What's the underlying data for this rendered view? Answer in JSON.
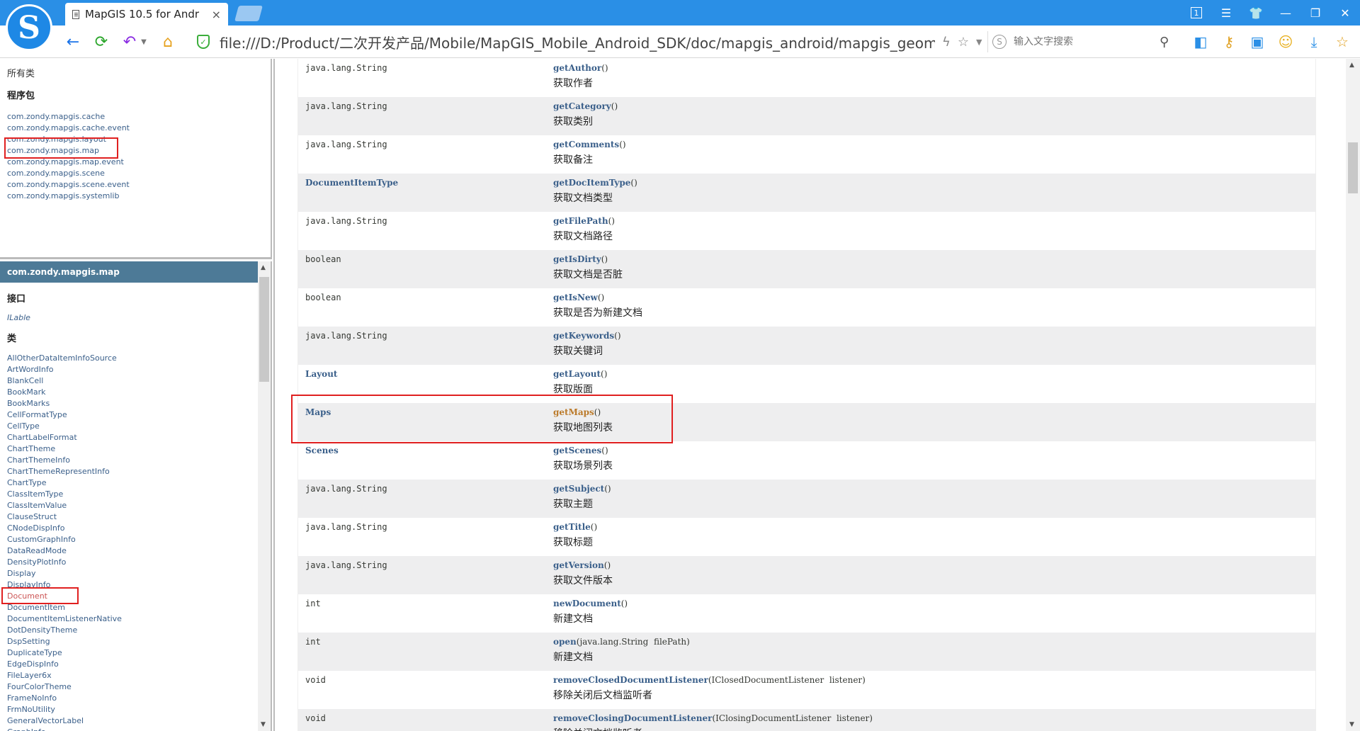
{
  "browser": {
    "tab_title": "MapGIS 10.5 for Andr",
    "tab_close": "×",
    "logo_letter": "S",
    "url": "file:///D:/Product/二次开发产品/Mobile/MapGIS_Mobile_Android_SDK/doc/mapgis_android/mapgis_geomap/ind",
    "search_placeholder": "输入文字搜索",
    "tab_count": "1"
  },
  "left_top": {
    "all_classes": "所有类",
    "packages_heading": "程序包",
    "packages": [
      "com.zondy.mapgis.cache",
      "com.zondy.mapgis.cache.event",
      "com.zondy.mapgis.layout",
      "com.zondy.mapgis.map",
      "com.zondy.mapgis.map.event",
      "com.zondy.mapgis.scene",
      "com.zondy.mapgis.scene.event",
      "com.zondy.mapgis.systemlib"
    ]
  },
  "left_bottom": {
    "package_name": "com.zondy.mapgis.map",
    "interfaces_heading": "接口",
    "interfaces": [
      "ILable"
    ],
    "classes_heading": "类",
    "classes": [
      "AllOtherDataItemInfoSource",
      "ArtWordInfo",
      "BlankCell",
      "BookMark",
      "BookMarks",
      "CellFormatType",
      "CellType",
      "ChartLabelFormat",
      "ChartTheme",
      "ChartThemeInfo",
      "ChartThemeRepresentInfo",
      "ChartType",
      "ClassItemType",
      "ClassItemValue",
      "ClauseStruct",
      "CNodeDispInfo",
      "CustomGraphInfo",
      "DataReadMode",
      "DensityPlotInfo",
      "Display",
      "DisplayInfo",
      "Document",
      "DocumentItem",
      "DocumentItemListenerNative",
      "DotDensityTheme",
      "DspSetting",
      "DuplicateType",
      "EdgeDispInfo",
      "FileLayer6x",
      "FourColorTheme",
      "FrameNoInfo",
      "FrmNoUtility",
      "GeneralVectorLabel",
      "GraphInfo"
    ]
  },
  "methods": [
    {
      "type": "java.lang.String",
      "name": "getAuthor",
      "params": "()",
      "desc": "获取作者"
    },
    {
      "type": "java.lang.String",
      "name": "getCategory",
      "params": "()",
      "desc": "获取类别"
    },
    {
      "type": "java.lang.String",
      "name": "getComments",
      "params": "()",
      "desc": "获取备注"
    },
    {
      "type": "DocumentItemType",
      "name": "getDocItemType",
      "params": "()",
      "desc": "获取文档类型"
    },
    {
      "type": "java.lang.String",
      "name": "getFilePath",
      "params": "()",
      "desc": "获取文档路径"
    },
    {
      "type": "boolean",
      "name": "getIsDirty",
      "params": "()",
      "desc": "获取文档是否脏"
    },
    {
      "type": "boolean",
      "name": "getIsNew",
      "params": "()",
      "desc": "获取是否为新建文档"
    },
    {
      "type": "java.lang.String",
      "name": "getKeywords",
      "params": "()",
      "desc": "获取关键词"
    },
    {
      "type": "Layout",
      "name": "getLayout",
      "params": "()",
      "desc": "获取版面"
    },
    {
      "type": "Maps",
      "name": "getMaps",
      "params": "()",
      "desc": "获取地图列表"
    },
    {
      "type": "Scenes",
      "name": "getScenes",
      "params": "()",
      "desc": "获取场景列表"
    },
    {
      "type": "java.lang.String",
      "name": "getSubject",
      "params": "()",
      "desc": "获取主题"
    },
    {
      "type": "java.lang.String",
      "name": "getTitle",
      "params": "()",
      "desc": "获取标题"
    },
    {
      "type": "java.lang.String",
      "name": "getVersion",
      "params": "()",
      "desc": "获取文件版本"
    },
    {
      "type": "int",
      "name": "newDocument",
      "params": "()",
      "desc": "新建文档"
    },
    {
      "type": "int",
      "name": "open",
      "params": "(java.lang.String  filePath)",
      "desc": "新建文档"
    },
    {
      "type": "void",
      "name": "removeClosedDocumentListener",
      "params": "(IClosedDocumentListener  listener)",
      "desc": "移除关闭后文档监听者"
    },
    {
      "type": "void",
      "name": "removeClosingDocumentListener",
      "params": "(IClosingDocumentListener  listener)",
      "desc": "移除关闭文档监听者"
    }
  ],
  "colors": {
    "header_blue": "#2a8fe6",
    "package_header": "#4d7a97",
    "link": "#3a5f8a",
    "highlight_box": "#e02020"
  }
}
